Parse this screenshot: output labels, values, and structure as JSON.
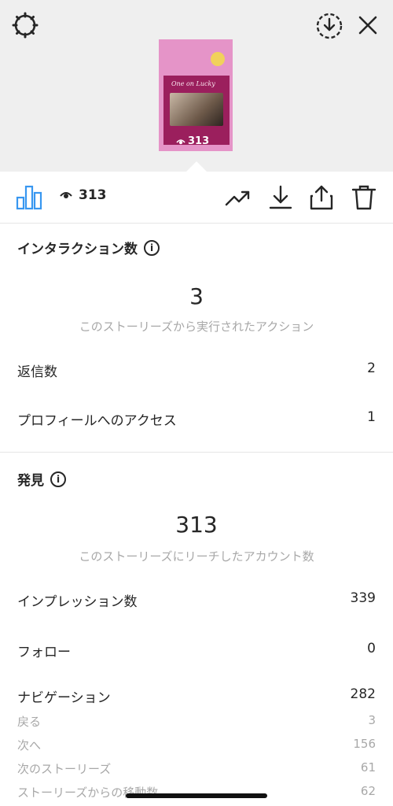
{
  "header": {
    "settings_icon": "gear-icon",
    "download_icon": "download-circle-icon",
    "close_icon": "close-icon"
  },
  "story_preview": {
    "script_text": "One on Lucky",
    "view_count": "313"
  },
  "toolbar": {
    "view_count": "313",
    "icons": [
      "bar-chart-icon",
      "eye-icon",
      "trend-icon",
      "download-icon",
      "share-icon",
      "trash-icon"
    ]
  },
  "interactions": {
    "title": "インタラクション数",
    "total": "3",
    "subtitle": "このストーリーズから実行されたアクション",
    "rows": [
      {
        "label": "返信数",
        "value": "2"
      },
      {
        "label": "プロフィールへのアクセス",
        "value": "1"
      }
    ]
  },
  "discovery": {
    "title": "発見",
    "total": "313",
    "subtitle": "このストーリーズにリーチしたアカウント数",
    "rows": [
      {
        "label": "インプレッション数",
        "value": "339"
      },
      {
        "label": "フォロー",
        "value": "0"
      },
      {
        "label": "ナビゲーション",
        "value": "282"
      }
    ],
    "sub_rows": [
      {
        "label": "戻る",
        "value": "3"
      },
      {
        "label": "次へ",
        "value": "156"
      },
      {
        "label": "次のストーリーズ",
        "value": "61"
      },
      {
        "label": "ストーリーズからの移動数",
        "value": "62"
      }
    ]
  },
  "colors": {
    "accent": "#3897f0",
    "preview_bg": "#e594c8",
    "preview_card": "#9b1f5d",
    "muted_text": "#a8a8a8"
  }
}
